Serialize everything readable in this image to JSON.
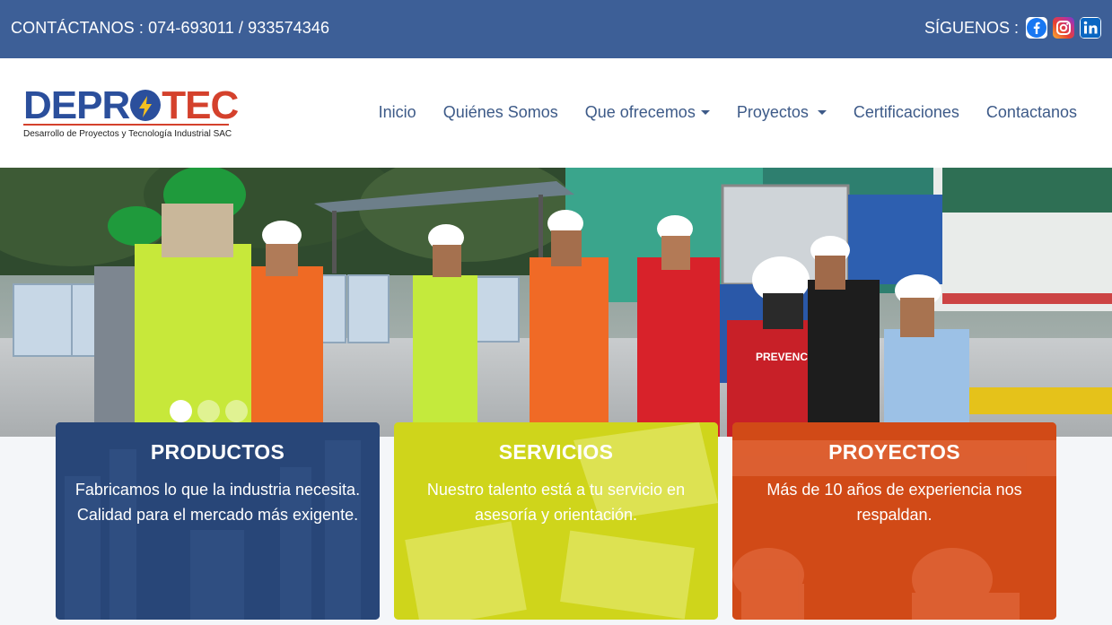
{
  "topbar": {
    "contact": "CONTÁCTANOS : 074-693011 / 933574346",
    "follow_label": "SÍGUENOS :",
    "social": [
      {
        "name": "facebook-icon",
        "color": "#1877f2"
      },
      {
        "name": "instagram-icon",
        "color": "#c1338f"
      },
      {
        "name": "linkedin-icon",
        "color": "#0a66c2"
      }
    ]
  },
  "logo": {
    "word_left": "DEPR",
    "word_right": "TEC",
    "subtitle": "Desarrollo de Proyectos y Tecnología Industrial SAC"
  },
  "nav": {
    "items": [
      {
        "label": "Inicio",
        "dropdown": false
      },
      {
        "label": "Quiénes Somos",
        "dropdown": false
      },
      {
        "label": "Que ofrecemos",
        "dropdown": true
      },
      {
        "label": "Proyectos",
        "dropdown": true
      },
      {
        "label": "Certificaciones",
        "dropdown": false
      },
      {
        "label": "Contactanos",
        "dropdown": false
      }
    ]
  },
  "hero": {
    "slides": 3,
    "active_slide": 1,
    "vest_text": "PREVENCIONISTA"
  },
  "cards": [
    {
      "title": "PRODUCTOS",
      "text": "Fabricamos lo que la industria necesita. Calidad para el mercado más exigente.",
      "color": "#2c4a7d"
    },
    {
      "title": "SERVICIOS",
      "text": "Nuestro talento está a tu servicio en asesoría y orientación.",
      "color": "#cfd51b"
    },
    {
      "title": "PROYECTOS",
      "text": "Más de 10 años de experiencia nos respaldan.",
      "color": "#d14a17"
    }
  ],
  "colors": {
    "topbar": "#3d5f97",
    "nav_text": "#3d5a88",
    "brand_blue": "#2b4f9c",
    "brand_red": "#d4412c"
  }
}
